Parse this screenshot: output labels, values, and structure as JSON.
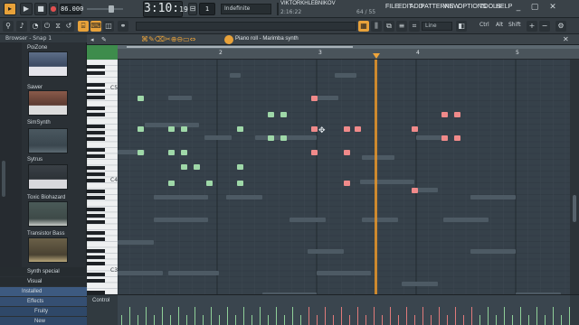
{
  "transport": {
    "tempo": "86.000",
    "time_main": "3:10:",
    "time_small": "19",
    "pattern_number": "1",
    "pattern_label": "Indefinite",
    "user": "VIKTORKHLEBNIKOV",
    "user_time": "2:16:22",
    "cpu": "64",
    "mem": "55",
    "menu": [
      "FILE",
      "EDIT",
      "ADD",
      "PATTERNS",
      "VIEW",
      "OPTIONS",
      "TOOLS",
      "HELP"
    ],
    "snap_line": "Line",
    "mods": [
      "Ctrl",
      "Alt",
      "Shift"
    ]
  },
  "browser": {
    "title": "Browser - Snap 1",
    "plugins": [
      "PoiZone",
      "Sawer",
      "SimSynth",
      "Sytrus",
      "Toxic Biohazard",
      "Transistor Bass"
    ],
    "tree": [
      "Synth special",
      "Visual",
      "Installed",
      "Effects",
      "Fruity",
      "New"
    ]
  },
  "piano_roll": {
    "title": "Piano roll - Marimba synth",
    "bars": [
      "2",
      "3",
      "4",
      "5"
    ],
    "octave_labels": [
      "C5",
      "C4",
      "C3"
    ],
    "control_label": "Control"
  },
  "colors": {
    "green_note": "#9fd8a8",
    "red_note": "#f08a8a",
    "playhead": "#e8962a",
    "accent": "#f0a53a"
  }
}
